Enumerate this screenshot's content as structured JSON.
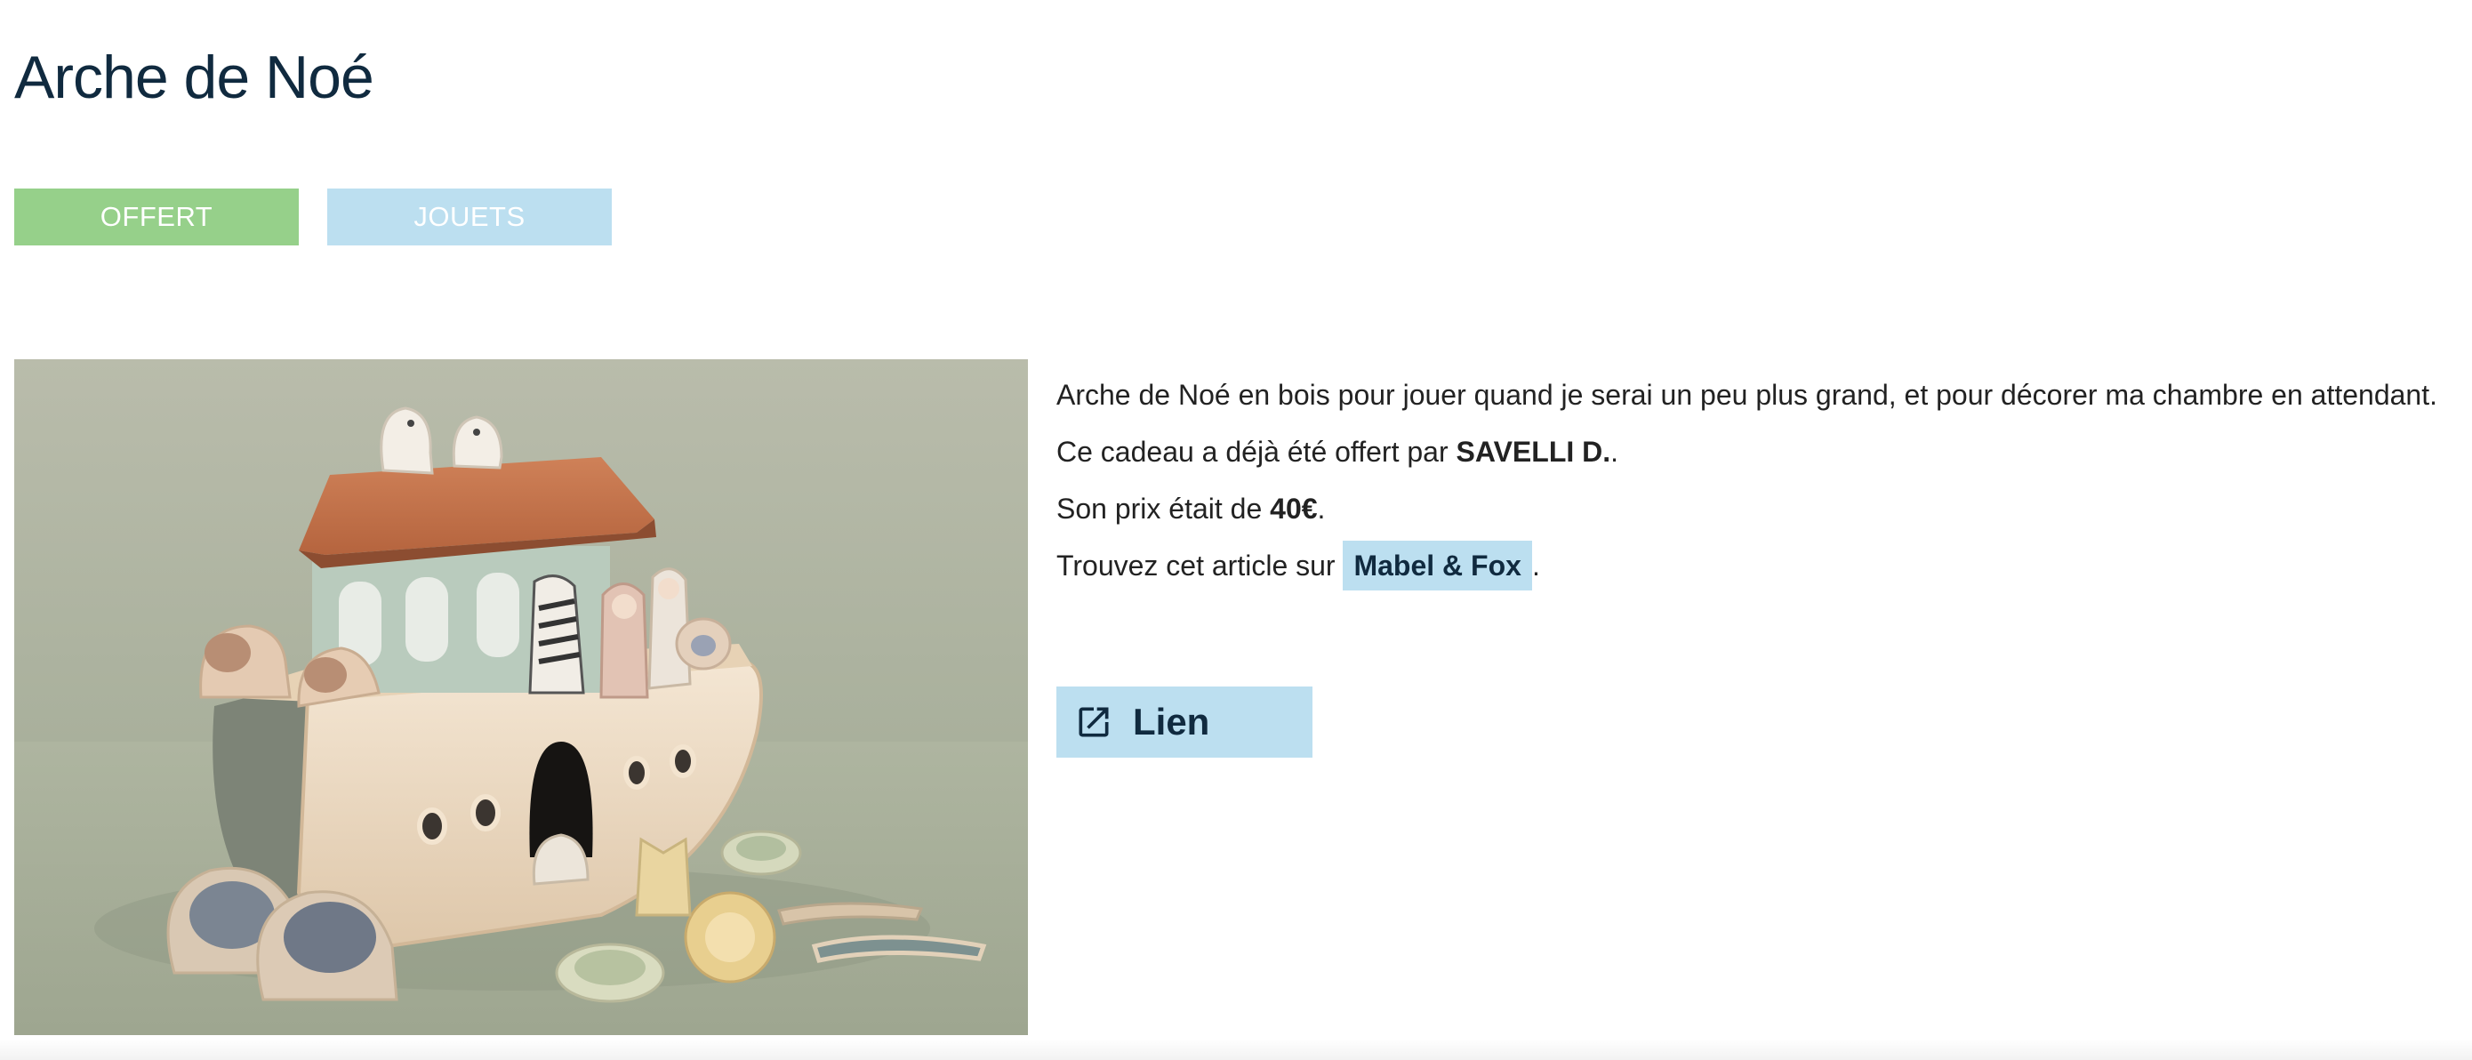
{
  "page": {
    "title": "Arche de Noé"
  },
  "tags": {
    "status": "OFFERT",
    "category": "JOUETS"
  },
  "product": {
    "image_alt": "Arche de Noé en bois avec animaux",
    "description": "Arche de Noé en bois pour jouer quand je serai un peu plus grand, et pour décorer ma chambre en attendant.",
    "offered_prefix": "Ce cadeau a déjà été offert par ",
    "offered_by": "SAVELLI D.",
    "offered_suffix": ".",
    "price_prefix": "Son prix était de ",
    "price": "40€",
    "price_suffix": ".",
    "shop_prefix": "Trouvez cet article sur ",
    "shop_name": "Mabel & Fox",
    "shop_suffix": "."
  },
  "actions": {
    "link_label": "Lien",
    "link_icon": "external-link-icon"
  },
  "colors": {
    "title": "#102a3f",
    "tag_offert": "#96d08a",
    "tag_jouets": "#bcdff0",
    "accent": "#bcdff0"
  }
}
